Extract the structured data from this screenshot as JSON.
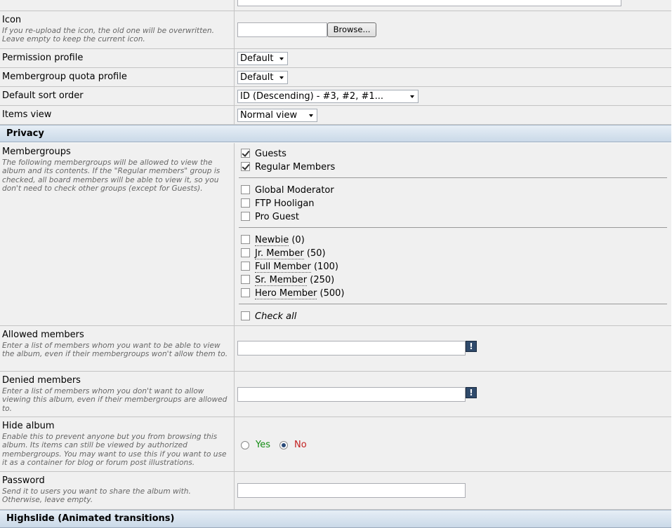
{
  "icon": {
    "label": "Icon",
    "description": "If you re-upload the icon, the old one will be overwritten. Leave empty to keep the current icon.",
    "browse_label": "Browse..."
  },
  "permission_profile": {
    "label": "Permission profile",
    "value": "Default"
  },
  "quota_profile": {
    "label": "Membergroup quota profile",
    "value": "Default"
  },
  "sort_order": {
    "label": "Default sort order",
    "value": "ID (Descending) - #3, #2, #1..."
  },
  "items_view": {
    "label": "Items view",
    "value": "Normal view"
  },
  "privacy": {
    "title": "Privacy",
    "membergroups": {
      "label": "Membergroups",
      "description": "The following membergroups will be allowed to view the album and its contents. If the \"Regular members\" group is checked, all board members will be able to view it, so you don't need to check other groups (except for Guests).",
      "basic": [
        {
          "name": "Guests",
          "checked": true
        },
        {
          "name": "Regular Members",
          "checked": true
        }
      ],
      "special": [
        {
          "name": "Global Moderator",
          "checked": false
        },
        {
          "name": "FTP Hooligan",
          "checked": false
        },
        {
          "name": "Pro Guest",
          "checked": false
        }
      ],
      "post_based": [
        {
          "name": "Newbie",
          "count": "(0)",
          "checked": false
        },
        {
          "name": "Jr. Member",
          "count": "(50)",
          "checked": false
        },
        {
          "name": "Full Member",
          "count": "(100)",
          "checked": false
        },
        {
          "name": "Sr. Member",
          "count": "(250)",
          "checked": false
        },
        {
          "name": "Hero Member",
          "count": "(500)",
          "checked": false
        }
      ],
      "check_all": "Check all"
    },
    "allowed_members": {
      "label": "Allowed members",
      "description": "Enter a list of members whom you want to be able to view the album, even if their membergroups won't allow them to."
    },
    "denied_members": {
      "label": "Denied members",
      "description": "Enter a list of members whom you don't want to allow viewing this album, even if their membergroups are allowed to."
    },
    "hide_album": {
      "label": "Hide album",
      "description": "Enable this to prevent anyone but you from browsing this album. Its items can still be viewed by authorized membergroups. You may want to use this if you want to use it as a container for blog or forum post illustrations.",
      "yes": "Yes",
      "no": "No",
      "selected": "No"
    },
    "password": {
      "label": "Password",
      "description": "Send it to users you want to share the album with. Otherwise, leave empty."
    }
  },
  "highslide": {
    "title": "Highslide (Animated transitions)"
  },
  "colors": {
    "section_bg": "#cad9e8",
    "row_bg": "#f0f0f0",
    "yes": "#138c13",
    "no": "#c21f1f",
    "info_icon": "#2f4a6b"
  }
}
